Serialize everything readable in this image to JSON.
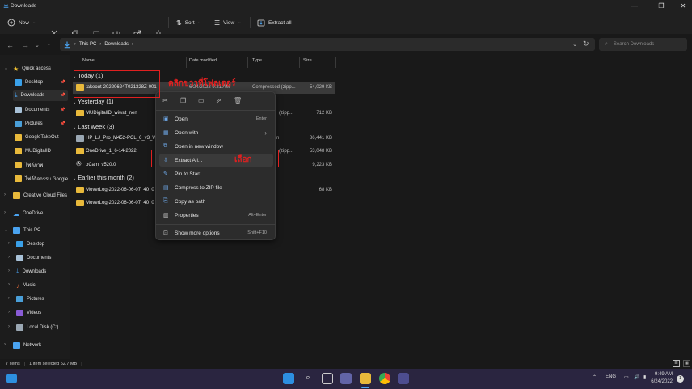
{
  "window": {
    "title": "Downloads"
  },
  "toolbar": {
    "new_label": "New",
    "sort_label": "Sort",
    "view_label": "View",
    "extract_all_label": "Extract all",
    "more_label": "···"
  },
  "address": {
    "crumbs": [
      "This PC",
      "Downloads"
    ],
    "search_placeholder": "Search Downloads"
  },
  "sidebar": {
    "quick_access": "Quick access",
    "quick_items": [
      {
        "label": "Desktop"
      },
      {
        "label": "Downloads"
      },
      {
        "label": "Documents"
      },
      {
        "label": "Pictures"
      },
      {
        "label": "GoogleTakeOut"
      },
      {
        "label": "MUDigitalID"
      },
      {
        "label": "ไฟล์ภาพ"
      },
      {
        "label": "ไฟล์กิจกรรม Google"
      }
    ],
    "creative_cloud": "Creative Cloud Files",
    "onedrive": "OneDrive",
    "this_pc": "This PC",
    "pc_items": [
      {
        "label": "Desktop"
      },
      {
        "label": "Documents"
      },
      {
        "label": "Downloads"
      },
      {
        "label": "Music"
      },
      {
        "label": "Pictures"
      },
      {
        "label": "Videos"
      },
      {
        "label": "Local Disk (C:)"
      }
    ],
    "network": "Network"
  },
  "columns": {
    "name": "Name",
    "date": "Date modified",
    "type": "Type",
    "size": "Size"
  },
  "groups": {
    "today": "Today (1)",
    "yesterday": "Yesterday (1)",
    "last_week": "Last week (3)",
    "earlier": "Earlier this month (2)"
  },
  "files": [
    {
      "name": "takeout-20220624T021328Z-001",
      "date": "6/24/2022 9:21 AM",
      "type": "Compressed (zipp...",
      "size": "54,029 KB"
    },
    {
      "name": "MUDigitalID_wiwat_nen",
      "date": "",
      "type": "(zipp...",
      "size": "712 KB"
    },
    {
      "name": "HP_LJ_Pro_M452-PCL_6_v3_Wi",
      "date": "",
      "type": "n",
      "size": "86,441 KB"
    },
    {
      "name": "OneDrive_1_6-14-2022",
      "date": "",
      "type": "(zipp...",
      "size": "53,048 KB"
    },
    {
      "name": "oCam_v520.0",
      "date": "",
      "type": "",
      "size": "9,223 KB"
    },
    {
      "name": "MoverLog-2022-06-06-07_40_0",
      "date": "",
      "type": "",
      "size": "68 KB"
    },
    {
      "name": "MoverLog-2022-06-06-07_40_0",
      "date": "",
      "type": "",
      "size": ""
    }
  ],
  "context_menu": {
    "items": [
      {
        "label": "Open",
        "shortcut": "Enter"
      },
      {
        "label": "Open with",
        "shortcut": "›"
      },
      {
        "label": "Open in new window",
        "shortcut": ""
      },
      {
        "label": "Extract All...",
        "shortcut": ""
      },
      {
        "label": "Pin to Start",
        "shortcut": ""
      },
      {
        "label": "Compress to ZIP file",
        "shortcut": ""
      },
      {
        "label": "Copy as path",
        "shortcut": ""
      },
      {
        "label": "Properties",
        "shortcut": "Alt+Enter"
      },
      {
        "label": "Show more options",
        "shortcut": "Shift+F10"
      }
    ]
  },
  "annotations": {
    "right_click_folder": "คลิกขวาที่โฟลเดอร์",
    "select": "เลือก"
  },
  "status": {
    "items": "7 items",
    "selected": "1 item selected  52.7 MB"
  },
  "taskbar": {
    "lang": "ENG",
    "time": "9:49 AM",
    "date": "6/24/2022",
    "notif_count": "1"
  },
  "colors": {
    "annotation_red": "#e02020",
    "folder_yellow": "#e8b93b",
    "accent_blue": "#4aa3f0"
  }
}
